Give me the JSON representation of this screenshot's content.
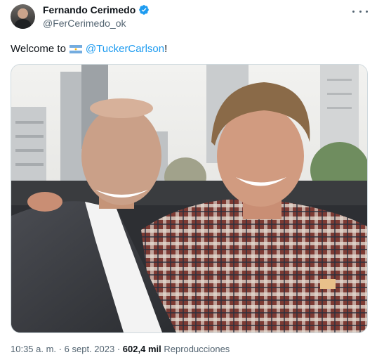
{
  "author": {
    "display_name": "Fernando Cerimedo",
    "handle": "@FerCerimedo_ok",
    "verified": true
  },
  "tweet": {
    "text_before": "Welcome to",
    "flag": "argentina-flag",
    "mention": "@TuckerCarlson",
    "text_after": "!"
  },
  "meta": {
    "time": "10:35 a. m.",
    "separator": "·",
    "date": "6 sept. 2023",
    "views_count": "602,4 mil",
    "views_label": "Reproducciones"
  },
  "colors": {
    "accent": "#1d9bf0",
    "text": "#0f1419",
    "secondary": "#536471",
    "border": "#cfd9de"
  }
}
